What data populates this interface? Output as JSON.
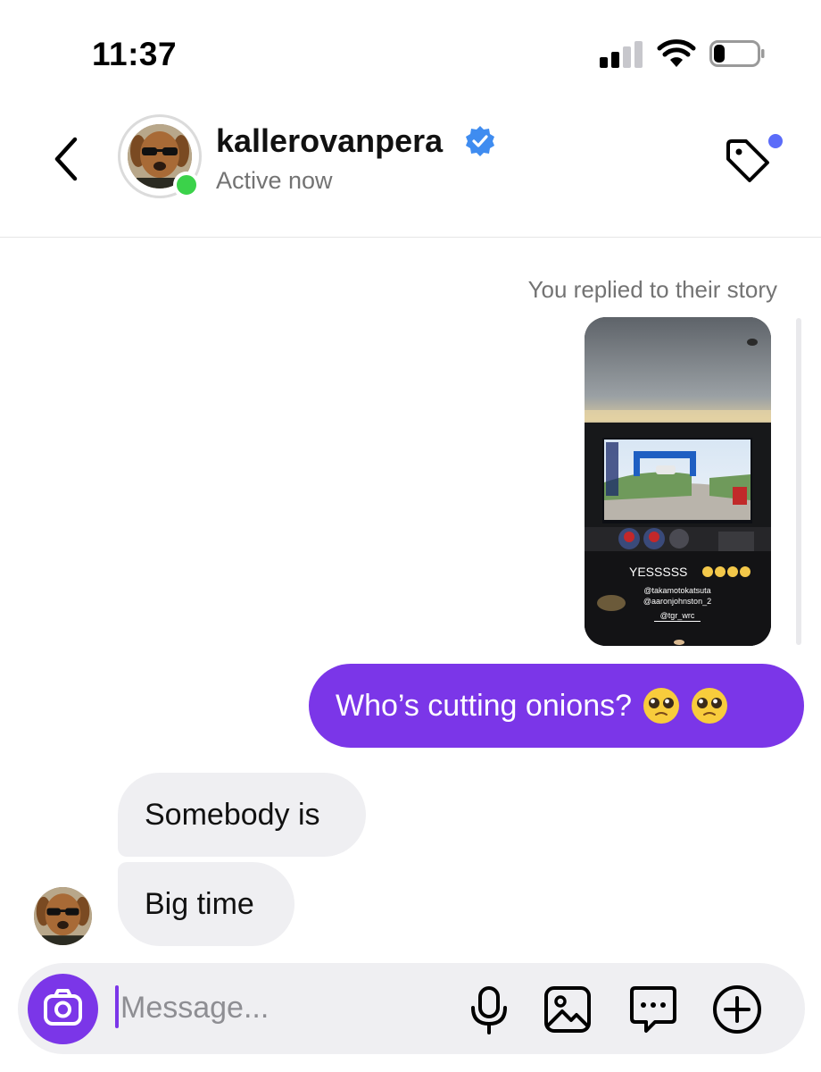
{
  "status_bar": {
    "time": "11:37",
    "signal_bars_active": 2,
    "signal_bars_total": 4,
    "battery_level": 0.25
  },
  "header": {
    "username": "kallerovanpera",
    "status": "Active now",
    "verified": true,
    "icons": [
      "chevron-left-icon",
      "verified-badge-icon",
      "tag-icon"
    ],
    "accent_dot_color": "#5b6cf9",
    "online_dot_color": "#3bd24a"
  },
  "chat": {
    "story_reply_note": "You replied to their story",
    "story": {
      "caption": "YESSSSS",
      "mentions": [
        "@takamotokatsuta",
        "@aaronjohnston_2",
        "@tgr_wrc"
      ]
    },
    "outgoing": [
      {
        "text": "Who’s cutting onions?",
        "emoji_count": 2
      }
    ],
    "incoming": [
      {
        "text": "Somebody is"
      },
      {
        "text": "Big time"
      }
    ]
  },
  "composer": {
    "placeholder": "Message...",
    "icons": [
      "camera-icon",
      "microphone-icon",
      "gallery-icon",
      "sticker-chat-icon",
      "plus-icon"
    ]
  },
  "colors": {
    "accent": "#7b36e8",
    "incoming_bubble": "#efeff2",
    "secondary_text": "#737373"
  }
}
